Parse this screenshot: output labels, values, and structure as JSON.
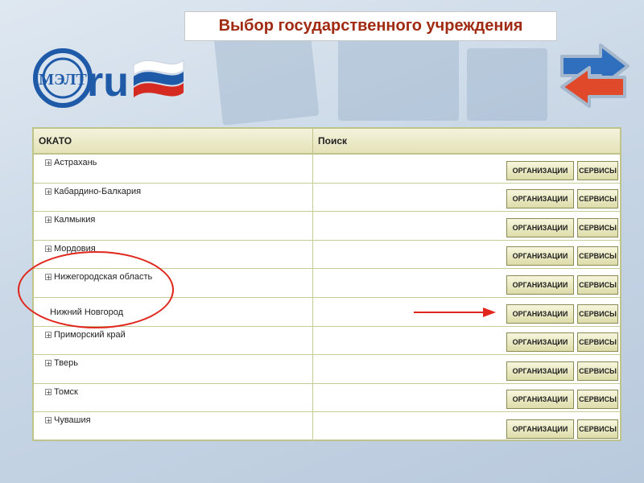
{
  "title": "Выбор государственного учреждения",
  "logo": {
    "brand": "MЭЛТ .ru"
  },
  "table": {
    "headers": {
      "okato": "ОКАТО",
      "search": "Поиск"
    },
    "button_labels": {
      "org": "ОРГАНИЗАЦИИ",
      "srv": "СЕРВИСЫ"
    },
    "rows": [
      {
        "name": "Астрахань",
        "expandable": true
      },
      {
        "name": "Кабардино-Балкария",
        "expandable": true
      },
      {
        "name": "Калмыкия",
        "expandable": true
      },
      {
        "name": "Мордовия",
        "expandable": true
      },
      {
        "name": "Нижегородская область",
        "expandable": true
      },
      {
        "name": "Нижний Новгород",
        "expandable": false
      },
      {
        "name": "Приморский край",
        "expandable": true
      },
      {
        "name": "Тверь",
        "expandable": true
      },
      {
        "name": "Томск",
        "expandable": true
      },
      {
        "name": "Чувашия",
        "expandable": true
      }
    ]
  },
  "colors": {
    "title_text": "#a02a12",
    "annotation": "#e0261d",
    "table_border": "#bfc58a",
    "button_bg": "#e8e7c0"
  },
  "icons": {
    "expand": "plus-square-icon",
    "nav": "two-way-arrows-icon"
  }
}
